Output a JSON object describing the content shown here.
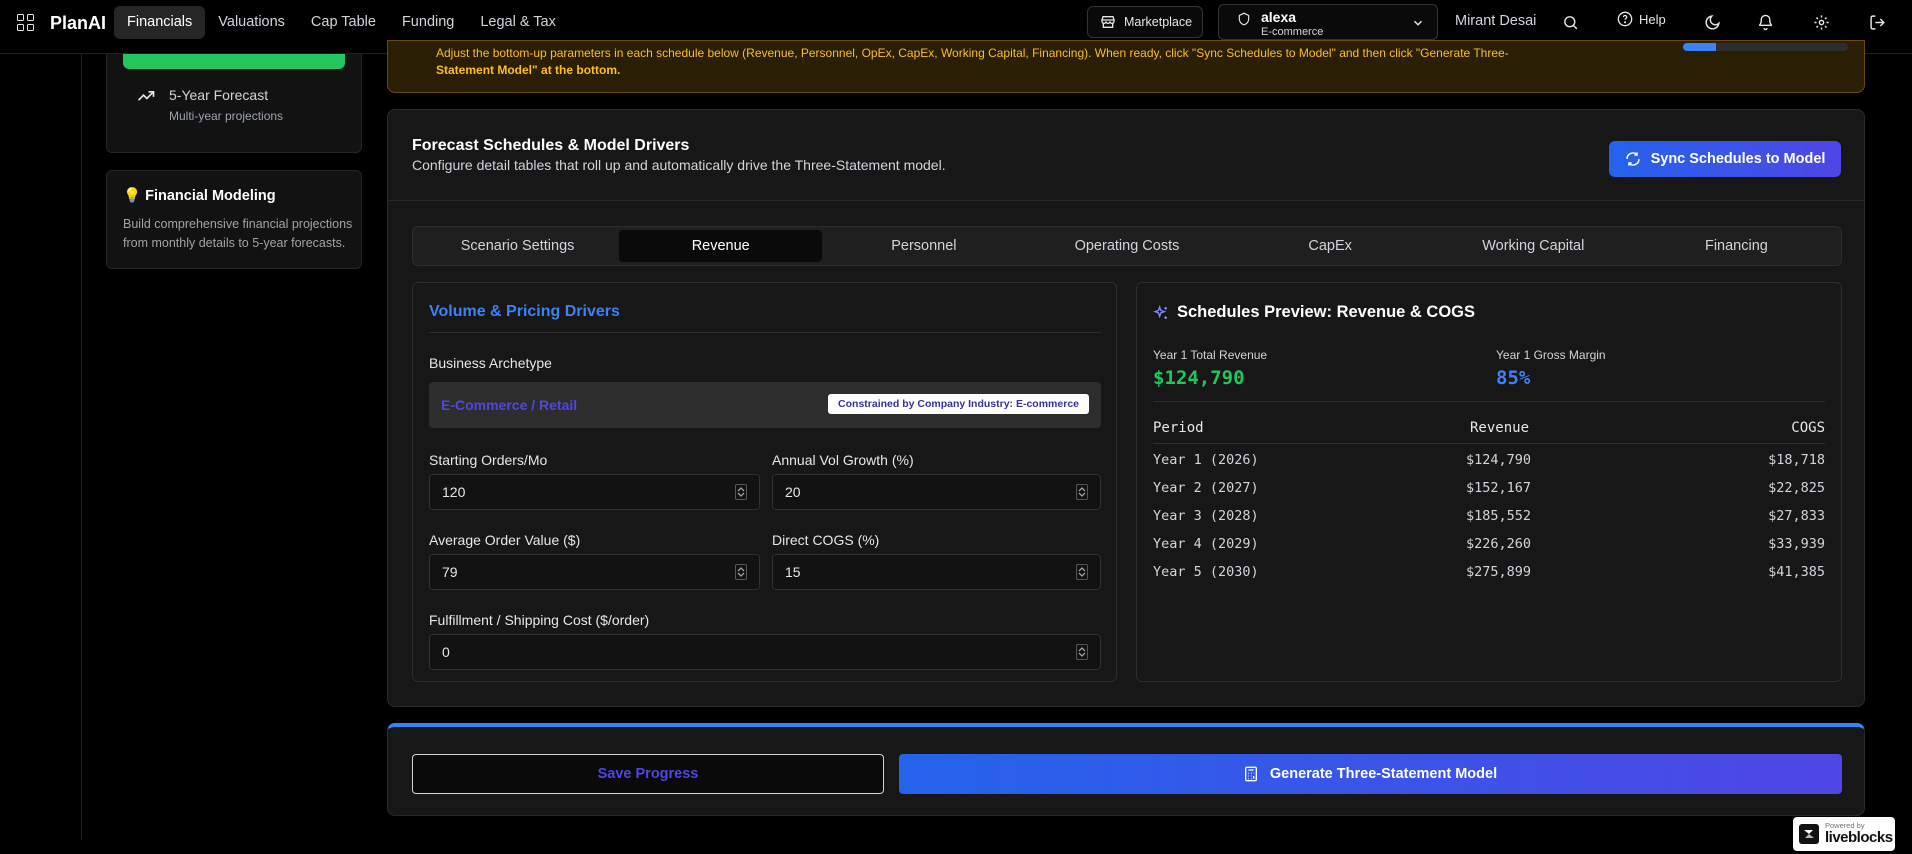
{
  "app": {
    "brand": "PlanAI",
    "nav": [
      "Financials",
      "Valuations",
      "Cap Table",
      "Funding",
      "Legal & Tax"
    ],
    "active_nav": "Financials"
  },
  "header": {
    "marketplace_label": "Marketplace",
    "org_name": "alexa",
    "org_type": "E-commerce",
    "user_name": "Mirant Desai",
    "help_label": "Help"
  },
  "sidebar": {
    "forecast_title": "5-Year Forecast",
    "forecast_sub": "Multi-year projections",
    "tip_icon": "💡",
    "tip_title": "Financial Modeling",
    "tip_text": "Build comprehensive financial projections from monthly details to 5-year forecasts."
  },
  "notice": {
    "line1": "Adjust the bottom-up parameters in each schedule below (Revenue, Personnel, OpEx, CapEx, Working Capital, Financing). When ready, click \"Sync Schedules to Model\" and then click \"Generate Three-",
    "line2": "Statement Model\" at the bottom.",
    "progress": 0.2
  },
  "panel": {
    "title": "Forecast Schedules & Model Drivers",
    "subtitle": "Configure detail tables that roll up and automatically drive the Three-Statement model.",
    "sync_label": "Sync Schedules to Model",
    "tabs": [
      "Scenario Settings",
      "Revenue",
      "Personnel",
      "Operating Costs",
      "CapEx",
      "Working Capital",
      "Financing"
    ],
    "active_tab": "Revenue"
  },
  "form": {
    "section_title": "Volume & Pricing Drivers",
    "archetype_label": "Business Archetype",
    "archetype_value": "E-Commerce / Retail",
    "archetype_badge": "Constrained by Company Industry: E-commerce",
    "starting_orders_label": "Starting Orders/Mo",
    "starting_orders_value": "120",
    "vol_growth_label": "Annual Vol Growth (%)",
    "vol_growth_value": "20",
    "aov_label": "Average Order Value ($)",
    "aov_value": "79",
    "cogs_label": "Direct COGS (%)",
    "cogs_value": "15",
    "fulfillment_label": "Fulfillment / Shipping Cost ($/order)",
    "fulfillment_value": "0"
  },
  "preview": {
    "title": "Schedules Preview: Revenue & COGS",
    "kpi1_label": "Year 1 Total Revenue",
    "kpi1_value": "$124,790",
    "kpi2_label": "Year 1 Gross Margin",
    "kpi2_value": "85%",
    "headers": [
      "Period",
      "Revenue",
      "COGS"
    ],
    "rows": [
      [
        "Year 1 (2026)",
        "$124,790",
        "$18,718"
      ],
      [
        "Year 2 (2027)",
        "$152,167",
        "$22,825"
      ],
      [
        "Year 3 (2028)",
        "$185,552",
        "$27,833"
      ],
      [
        "Year 4 (2029)",
        "$226,260",
        "$33,939"
      ],
      [
        "Year 5 (2030)",
        "$275,899",
        "$41,385"
      ]
    ]
  },
  "footer": {
    "save_label": "Save Progress",
    "generate_label": "Generate Three-Statement Model"
  },
  "badge": {
    "powered_by": "Powered by",
    "name": "liveblocks"
  },
  "colors": {
    "accent_blue": "#3b82f6",
    "indigo": "#4f46e5",
    "green": "#22c55e",
    "amber": "#fbbf24"
  }
}
